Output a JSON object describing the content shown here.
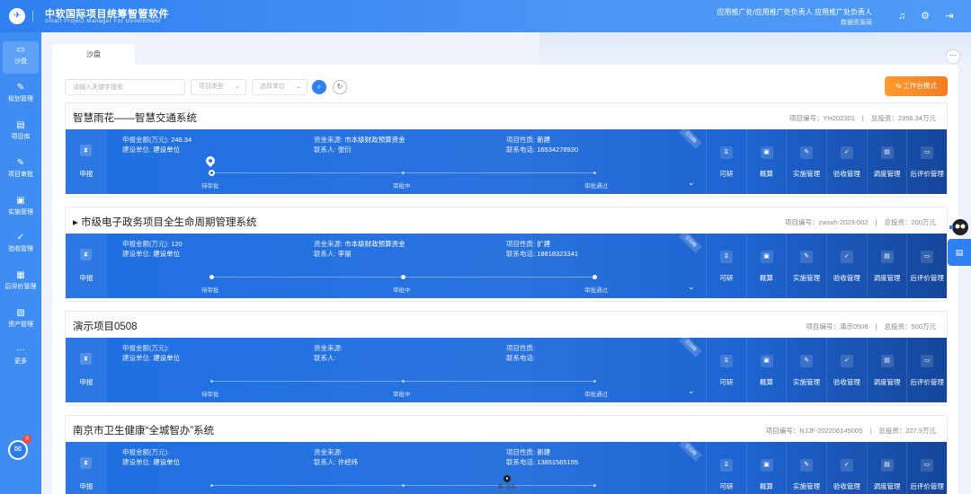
{
  "app": {
    "brand_cn": "中软国际项目统筹智管软件",
    "brand_en": "Smart Project Manager For Government",
    "logo_glyph": "✈",
    "user_roles": "应用推广处/应用推广处负责人 应用推广处负责人",
    "user_unit": "数据资源局"
  },
  "colors": {
    "primary": "#2f80f0",
    "accent_orange": "#f57c1f",
    "card_dark": "#15469a"
  },
  "sidebar": {
    "items": [
      {
        "label": "沙盘",
        "icon": "sandbox-icon",
        "glyph": "▭",
        "active": true
      },
      {
        "label": "规划管理",
        "icon": "planning-icon",
        "glyph": "✎",
        "active": false
      },
      {
        "label": "项目库",
        "icon": "library-icon",
        "glyph": "▤",
        "active": false
      },
      {
        "label": "项目审批",
        "icon": "approve-icon",
        "glyph": "✎",
        "active": false
      },
      {
        "label": "实施管理",
        "icon": "implement-icon",
        "glyph": "▣",
        "active": false
      },
      {
        "label": "验收管理",
        "icon": "acceptance-icon",
        "glyph": "✓",
        "active": false
      },
      {
        "label": "后评价管理",
        "icon": "evaluation-icon",
        "glyph": "▦",
        "active": false
      },
      {
        "label": "资产管理",
        "icon": "asset-icon",
        "glyph": "▧",
        "active": false
      },
      {
        "label": "更多",
        "icon": "more-icon",
        "glyph": "···",
        "active": false
      }
    ],
    "help_badge": "0"
  },
  "tabs": [
    {
      "label": "沙盘"
    }
  ],
  "toolbar": {
    "search_placeholder": "请输入关键字搜索",
    "type_placeholder": "项目类型",
    "unit_placeholder": "选择单位",
    "workbench_label": "⇆ 工作台模式"
  },
  "labels": {
    "amount": "申报金额(万元):",
    "funding": "资金来源:",
    "nature": "项目性质:",
    "builder": "建设单位:",
    "contact": "联系人:",
    "phone": "联系电话:",
    "stage": "申报",
    "steps": [
      "待审批",
      "审批中",
      "审批通过"
    ],
    "ribbon": "已归档"
  },
  "actions": [
    "可研",
    "概算",
    "实施管理",
    "验收管理",
    "调度管理",
    "后评价管理"
  ],
  "projects": [
    {
      "title": "智慧雨花——智慧交通系统",
      "code": "项目编号：YH202301",
      "invest": "总投资：2356.34万元",
      "amount": "248.34",
      "funding": "市本级财政预算资金",
      "nature": "新建",
      "builder": "建设单位",
      "contact": "张衍",
      "phone": "16534278920",
      "progress_step": 1
    },
    {
      "title": "▸ 市级电子政务项目全生命周期管理系统",
      "code": "项目编号：zwxxh-2023-002",
      "invest": "总投资：200万元",
      "amount": "120",
      "funding": "市本级财政预算资金",
      "nature": "扩建",
      "builder": "建设单位",
      "contact": "李丽",
      "phone": "18818323341",
      "progress_step": 3
    },
    {
      "title": "演示项目0508",
      "code": "项目编号：演示0508",
      "invest": "总投资：500万元",
      "amount": "",
      "funding": "",
      "nature": "",
      "builder": "建设单位",
      "contact": "",
      "phone": "",
      "progress_step": 0
    },
    {
      "title": "南京市卫生健康“全城智办”系统",
      "code": "项目编号：NJJF-202206145005",
      "invest": "总投资：227.9万元",
      "amount": "",
      "funding": "",
      "nature": "新建",
      "builder": "建设单位",
      "contact": "许经纬",
      "phone": "13851565155",
      "progress_step": 0
    }
  ],
  "bottom_label": "断 动态"
}
